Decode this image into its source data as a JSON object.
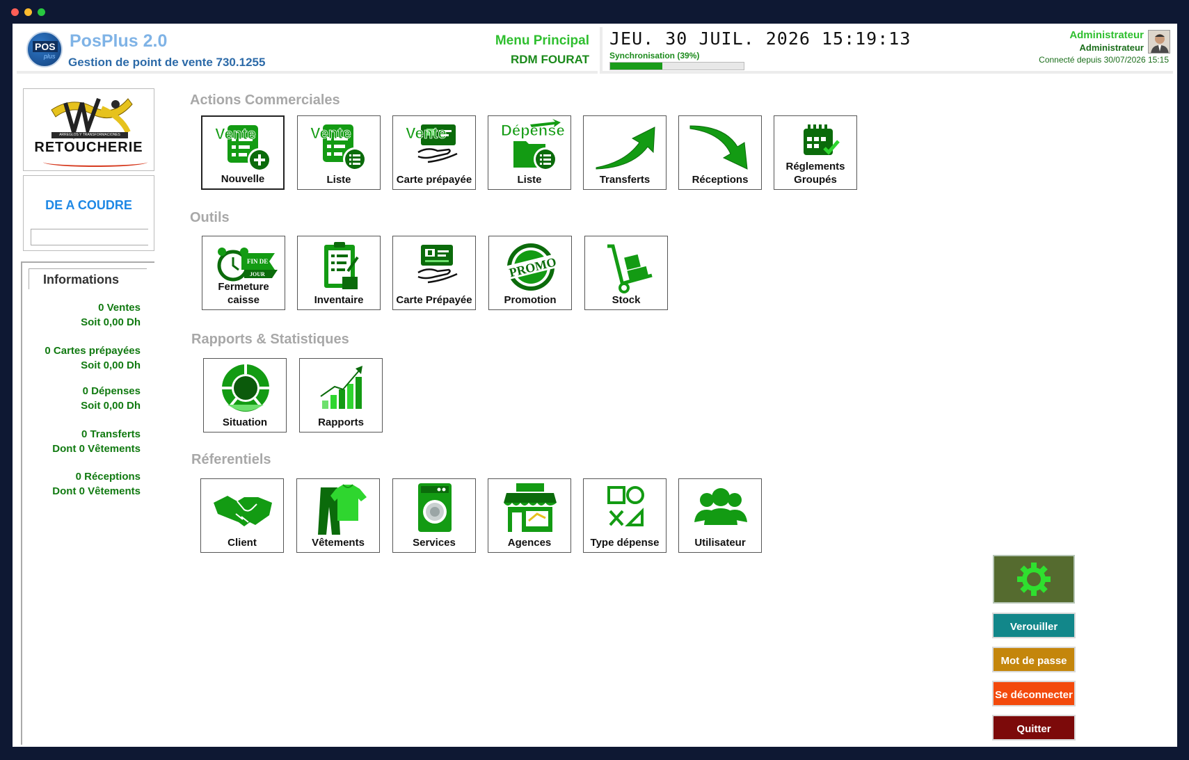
{
  "header": {
    "app_title": "PosPlus 2.0",
    "app_subtitle": "Gestion de point de vente 730.1255",
    "logo_text": "POS",
    "logo_sub": "plus",
    "menu_title": "Menu Principal",
    "menu_location": "RDM FOURAT",
    "datetime": "JEU. 30 JUIL. 2026 15:19:13",
    "sync_label": "Synchronisation (39%)",
    "sync_progress": 0.39,
    "user_name": "Administrateur",
    "user_role": "Administrateur",
    "connected_since": "Connecté depuis 30/07/2026 15:15"
  },
  "sidebar": {
    "brand": "RETOUCHERIE",
    "brand_tag": "ARREGLOS Y TRANSFORMACIONES",
    "agency_name": "DE A COUDRE",
    "info_title": "Informations",
    "info": [
      "0 Ventes",
      "Soit 0,00 Dh",
      "0 Cartes prépayées",
      "Soit 0,00 Dh",
      "0 Dépenses",
      "Soit 0,00 Dh",
      "0 Transferts",
      "Dont 0 Vêtements",
      "0 Réceptions",
      "Dont 0 Vêtements"
    ]
  },
  "sections": [
    {
      "title": "Actions Commerciales",
      "tiles": [
        {
          "label": "Nouvelle",
          "icon": "sale-new-icon",
          "badge": "Vente"
        },
        {
          "label": "Liste",
          "icon": "sale-list-icon",
          "badge": "Vente"
        },
        {
          "label": "Carte prépayée",
          "icon": "prepaid-card-sale-icon",
          "badge": "Vente"
        },
        {
          "label": "Liste",
          "icon": "expense-list-icon",
          "badge": "Dépense"
        },
        {
          "label": "Transferts",
          "icon": "transfer-arrow-icon"
        },
        {
          "label": "Réceptions",
          "icon": "reception-arrow-icon"
        },
        {
          "label": "Réglements Groupés",
          "icon": "calendar-check-icon"
        }
      ]
    },
    {
      "title": "Outils",
      "tiles": [
        {
          "label": "Fermeture caisse",
          "icon": "alarm-clock-icon",
          "badge1": "FIN DE",
          "badge2": "JOUR"
        },
        {
          "label": "Inventaire",
          "icon": "clipboard-icon"
        },
        {
          "label": "Carte Prépayée",
          "icon": "prepaid-card-icon"
        },
        {
          "label": "Promotion",
          "icon": "promo-stamp-icon",
          "badge": "PROMO"
        },
        {
          "label": "Stock",
          "icon": "hand-truck-icon"
        }
      ]
    },
    {
      "title": "Rapports & Statistiques",
      "tiles": [
        {
          "label": "Situation",
          "icon": "situation-icon"
        },
        {
          "label": "Rapports",
          "icon": "bar-chart-icon"
        }
      ]
    },
    {
      "title": "Réferentiels",
      "tiles": [
        {
          "label": "Client",
          "icon": "handshake-icon"
        },
        {
          "label": "Vêtements",
          "icon": "clothes-icon"
        },
        {
          "label": "Services",
          "icon": "washing-machine-icon"
        },
        {
          "label": "Agences",
          "icon": "store-icon"
        },
        {
          "label": "Type dépense",
          "icon": "shapes-icon"
        },
        {
          "label": "Utilisateur",
          "icon": "users-icon"
        }
      ]
    }
  ],
  "actions": {
    "lock": "Verouiller",
    "password": "Mot de passe",
    "logout": "Se déconnecter",
    "quit": "Quitter"
  },
  "colors": {
    "icon_green": "#139b13",
    "dark_green": "#0b6b0b",
    "lock_button": "#12878a",
    "password_button": "#c4860c",
    "logout_button": "#f34a0c",
    "quit_button": "#7c0a0a",
    "settings_button": "#556b2f"
  }
}
